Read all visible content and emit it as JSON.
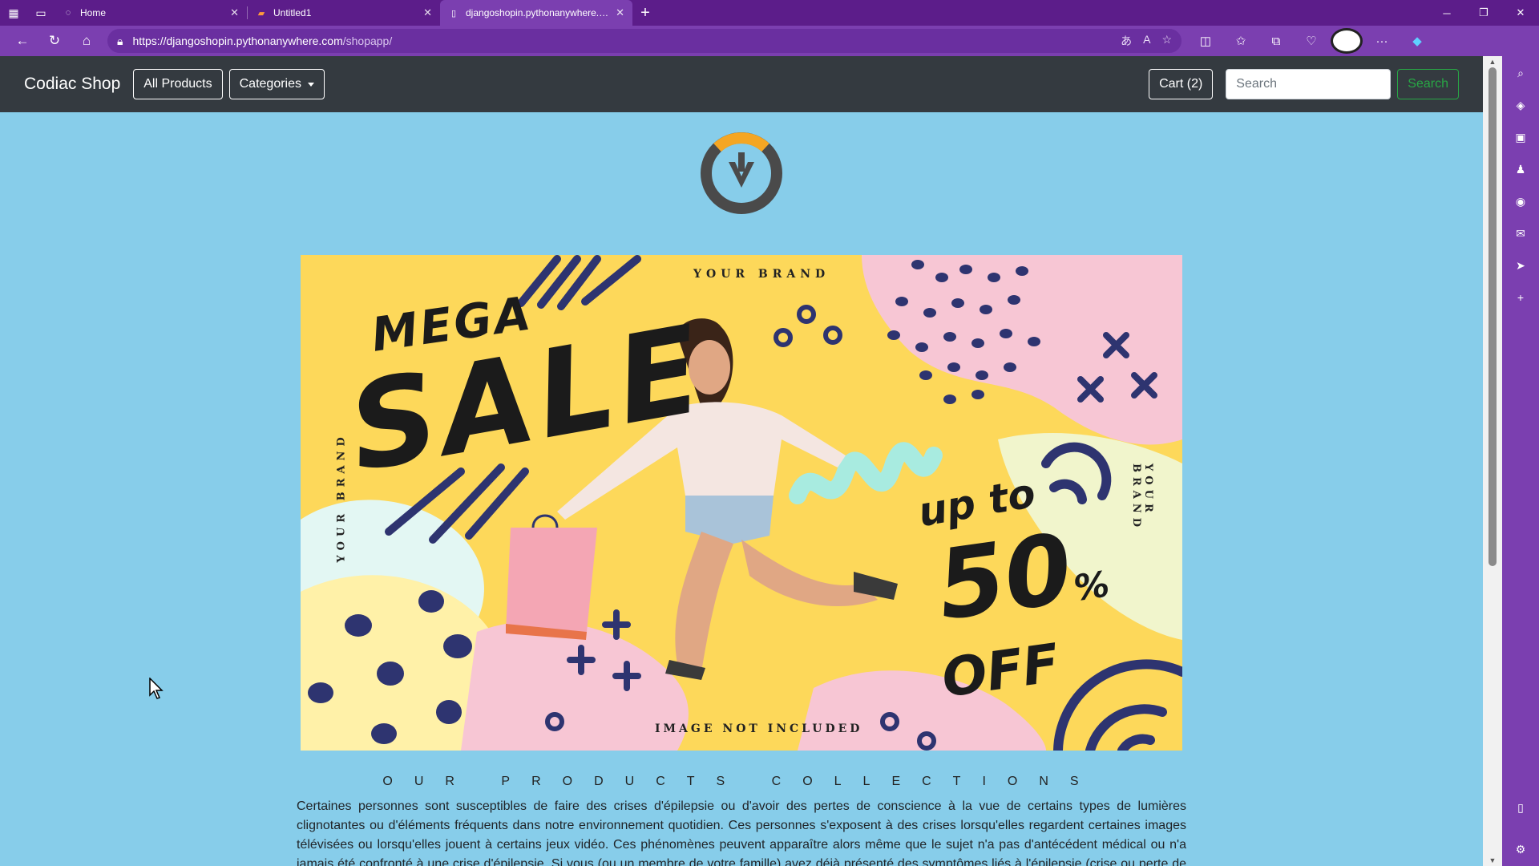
{
  "browser": {
    "tabs": [
      {
        "title": "Home",
        "active": false
      },
      {
        "title": "Untitled1",
        "active": false
      },
      {
        "title": "djangoshopin.pythonanywhere.com",
        "active": true
      }
    ],
    "url_host": "https://djangoshopin.pythonanywhere.com",
    "url_path": "/shopapp/"
  },
  "navbar": {
    "brand": "Codiac Shop",
    "all_products": "All Products",
    "categories": "Categories",
    "cart": "Cart (2)",
    "search_placeholder": "Search",
    "search_button": "Search"
  },
  "banner": {
    "your_brand": "YOUR BRAND",
    "mega": "MEGA",
    "sale": "SALE",
    "up_to": "up to",
    "fifty": "50",
    "percent": "%",
    "off": "OFF",
    "image_not_included": "IMAGE NOT INCLUDED"
  },
  "content": {
    "collections_title": "OUR PRODUCTS COLLECTIONS",
    "description": "Certaines personnes sont susceptibles de faire des crises d'épilepsie ou d'avoir des pertes de conscience à la vue de certains types de lumières clignotantes ou d'éléments fréquents dans notre environnement quotidien. Ces personnes s'exposent à des crises lorsqu'elles regardent certaines images télévisées ou lorsqu'elles jouent à certains jeux vidéo. Ces phénomènes peuvent apparaître alors même que le sujet n'a pas d'antécédent médical ou n'a jamais été confronté à une crise d'épilepsie. Si vous (ou un membre de votre famille) avez déjà présenté des symptômes liés à l'épilepsie (crise ou perte de conscience)"
  },
  "colors": {
    "navbar_bg": "#343a40",
    "page_bg": "#87cdea",
    "banner_yellow": "#fdd85a",
    "banner_navy": "#2e3470",
    "search_green": "#28a745",
    "logo_orange": "#f5a623",
    "logo_gray": "#4a4a4a"
  }
}
